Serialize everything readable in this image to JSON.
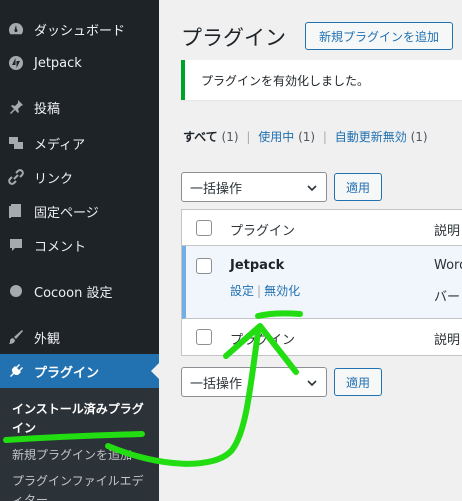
{
  "sidebar": {
    "items": [
      {
        "label": "ダッシュボード",
        "icon": "dashboard-icon"
      },
      {
        "label": "Jetpack",
        "icon": "jetpack-icon"
      },
      {
        "label": "投稿",
        "icon": "pin-icon"
      },
      {
        "label": "メディア",
        "icon": "media-icon"
      },
      {
        "label": "リンク",
        "icon": "link-icon"
      },
      {
        "label": "固定ページ",
        "icon": "page-icon"
      },
      {
        "label": "コメント",
        "icon": "comment-icon"
      },
      {
        "label": "Cocoon 設定",
        "icon": "cocoon-icon"
      },
      {
        "label": "外観",
        "icon": "brush-icon"
      },
      {
        "label": "プラグイン",
        "icon": "plugin-icon",
        "active": true
      }
    ],
    "submenu": [
      {
        "label": "インストール済みプラグイン",
        "current": true
      },
      {
        "label": "新規プラグインを追加"
      },
      {
        "label": "プラグインファイルエディター"
      }
    ]
  },
  "header": {
    "title": "プラグイン",
    "add_new_label": "新規プラグインを追加"
  },
  "notice": {
    "message": "プラグインを有効化しました。",
    "color": "#00a32a"
  },
  "filters": {
    "all_label": "すべて",
    "all_count": "(1)",
    "active_label": "使用中",
    "active_count": "(1)",
    "autoupdate_label": "自動更新無効",
    "autoupdate_count": "(1)"
  },
  "bulk": {
    "select_label": "一括操作",
    "apply_label": "適用"
  },
  "table": {
    "header": {
      "name": "プラグイン",
      "desc": "説明"
    },
    "rows": [
      {
        "name": "Jetpack",
        "desc": "Word",
        "desc2": "バー",
        "actions": [
          "設定",
          "無効化"
        ]
      }
    ],
    "footer": {
      "name": "プラグイン",
      "desc": "説明"
    }
  },
  "colors": {
    "accent": "#2271b1",
    "sidebar": "#1d2327",
    "highlight": "#22dd11"
  }
}
